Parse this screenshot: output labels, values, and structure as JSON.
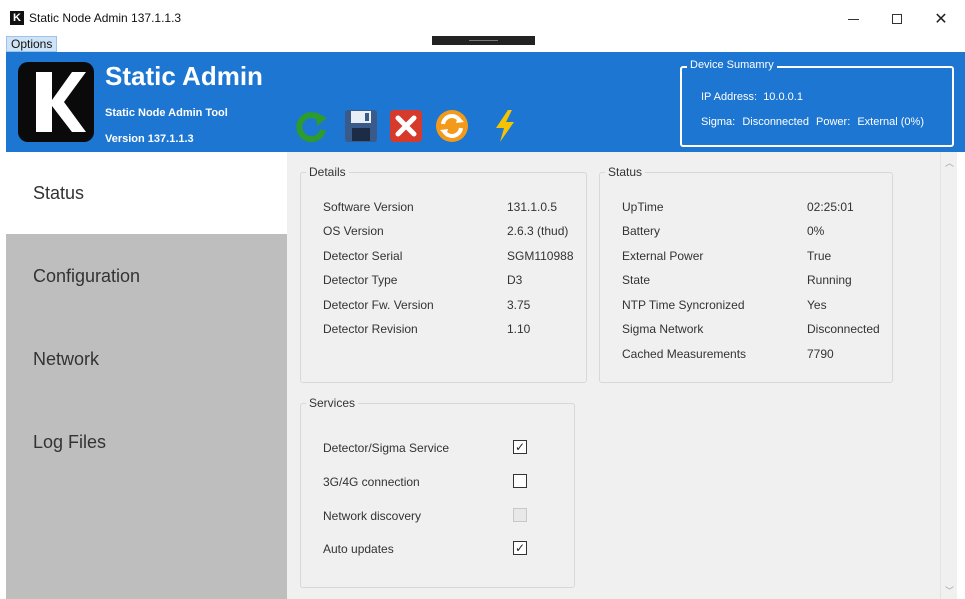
{
  "window": {
    "title": "Static Node Admin 137.1.1.3",
    "icon_letter": "K",
    "minimize_icon": "minimize-icon",
    "maximize_icon": "maximize-icon",
    "close_glyph": "✕"
  },
  "menu": {
    "options_label": "Options"
  },
  "header": {
    "app_name": "Static Admin",
    "subtitle": "Static Node Admin Tool",
    "version": "Version 137.1.1.3",
    "accent_color": "#1c76d2",
    "toolbar": [
      "refresh-icon",
      "save-icon",
      "cancel-icon",
      "sync-icon",
      "power-icon"
    ]
  },
  "summary": {
    "title": "Device Sumamry",
    "ip_label": "IP Address:",
    "ip_value": "10.0.0.1",
    "sigma_label": "Sigma:",
    "sigma_value": "Disconnected",
    "power_label": "Power:",
    "power_value": "External (0%)"
  },
  "sidebar": {
    "items": [
      {
        "label": "Status",
        "active": true
      },
      {
        "label": "Configuration",
        "active": false
      },
      {
        "label": "Network",
        "active": false
      },
      {
        "label": "Log Files",
        "active": false
      }
    ]
  },
  "details": {
    "title": "Details",
    "rows": [
      {
        "label": "Software Version",
        "value": "131.1.0.5"
      },
      {
        "label": "OS Version",
        "value": "2.6.3 (thud)"
      },
      {
        "label": "Detector Serial",
        "value": "SGM110988"
      },
      {
        "label": "Detector Type",
        "value": "D3"
      },
      {
        "label": "Detector Fw. Version",
        "value": "3.75"
      },
      {
        "label": "Detector Revision",
        "value": "1.10"
      }
    ]
  },
  "status": {
    "title": "Status",
    "rows": [
      {
        "label": "UpTime",
        "value": "02:25:01"
      },
      {
        "label": "Battery",
        "value": "0%"
      },
      {
        "label": "External Power",
        "value": "True"
      },
      {
        "label": "State",
        "value": "Running"
      },
      {
        "label": "NTP Time Syncronized",
        "value": "Yes"
      },
      {
        "label": "Sigma Network",
        "value": "Disconnected"
      },
      {
        "label": "Cached Measurements",
        "value": "7790"
      }
    ]
  },
  "services": {
    "title": "Services",
    "check_glyph": "✓",
    "items": [
      {
        "label": "Detector/Sigma Service",
        "checked": true,
        "enabled": true
      },
      {
        "label": "3G/4G connection",
        "checked": false,
        "enabled": true
      },
      {
        "label": "Network discovery",
        "checked": false,
        "enabled": false
      },
      {
        "label": "Auto updates",
        "checked": true,
        "enabled": true
      }
    ]
  }
}
